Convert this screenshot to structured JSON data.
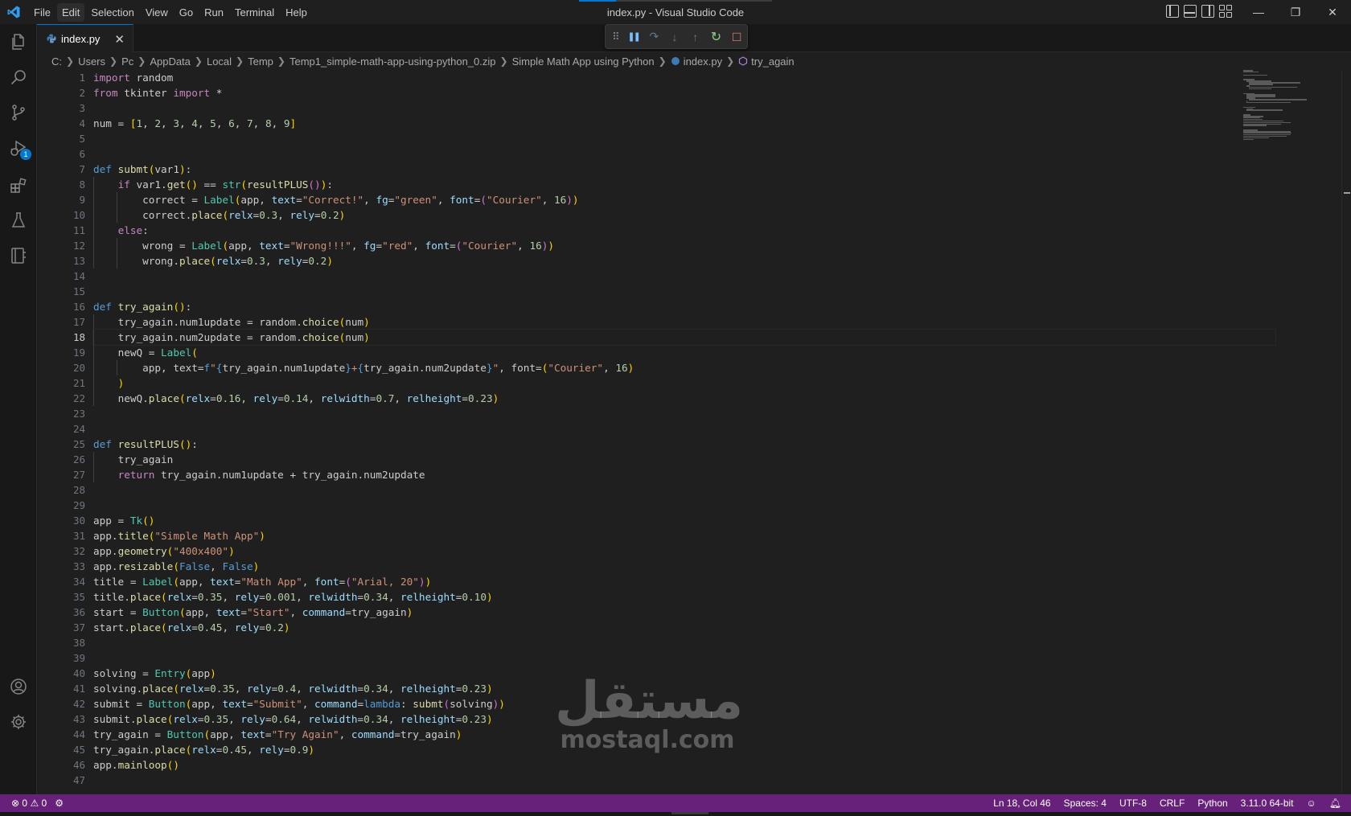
{
  "window": {
    "title": "index.py - Visual Studio Code",
    "menu": [
      "File",
      "Edit",
      "Selection",
      "View",
      "Go",
      "Run",
      "Terminal",
      "Help"
    ],
    "active_menu": "Edit",
    "controls": {
      "minimize": "—",
      "restore": "❐",
      "close": "✕"
    }
  },
  "activity_bar": {
    "items": [
      "explorer",
      "search",
      "source-control",
      "run-and-debug",
      "extensions",
      "testing",
      "remote-explorer"
    ],
    "debug_badge": "1",
    "bottom": [
      "accounts",
      "manage"
    ]
  },
  "tab": {
    "label": "index.py",
    "close": "✕",
    "language_icon": "python-icon"
  },
  "debug_toolbar": {
    "items": [
      "drag-handle",
      "pause",
      "step-over",
      "step-into",
      "step-out",
      "restart",
      "stop"
    ],
    "glyphs": {
      "grip": "⠿",
      "pause": "❚❚",
      "step_over": "↷",
      "step_into": "↓",
      "step_out": "↑",
      "restart": "↻",
      "stop": "□"
    }
  },
  "editor_actions": {
    "run": "▷",
    "run_menu": "⌄",
    "split": "◫",
    "more": "···"
  },
  "breadcrumb": {
    "segments": [
      "C:",
      "Users",
      "Pc",
      "AppData",
      "Local",
      "Temp",
      "Temp1_simple-math-app-using-python_0.zip",
      "Simple Math App using Python",
      "index.py",
      "try_again"
    ]
  },
  "editor": {
    "current_line": 18,
    "line_numbers": [
      "1",
      "2",
      "3",
      "4",
      "5",
      "6",
      "7",
      "8",
      "9",
      "10",
      "11",
      "12",
      "13",
      "14",
      "15",
      "16",
      "17",
      "18",
      "19",
      "20",
      "21",
      "22",
      "23",
      "24",
      "25",
      "26",
      "27",
      "28",
      "29",
      "30",
      "31",
      "32",
      "33",
      "34",
      "35",
      "36",
      "37",
      "38",
      "39",
      "40",
      "41",
      "42",
      "43",
      "44",
      "45",
      "46",
      "47"
    ],
    "lines": [
      "import random",
      "from tkinter import *",
      "",
      "num = [1, 2, 3, 4, 5, 6, 7, 8, 9]",
      "",
      "",
      "def submt(var1):",
      "    if var1.get() == str(resultPLUS()):",
      "        correct = Label(app, text=\"Correct!\", fg=\"green\", font=(\"Courier\", 16))",
      "        correct.place(relx=0.3, rely=0.2)",
      "    else:",
      "        wrong = Label(app, text=\"Wrong!!!\", fg=\"red\", font=(\"Courier\", 16))",
      "        wrong.place(relx=0.3, rely=0.2)",
      "",
      "",
      "def try_again():",
      "    try_again.num1update = random.choice(num)",
      "    try_again.num2update = random.choice(num)",
      "    newQ = Label(",
      "        app, text=f\"{try_again.num1update}+{try_again.num2update}\", font=(\"Courier\", 16)",
      "    )",
      "    newQ.place(relx=0.16, rely=0.14, relwidth=0.7, relheight=0.23)",
      "",
      "",
      "def resultPLUS():",
      "    try_again",
      "    return try_again.num1update + try_again.num2update",
      "",
      "",
      "app = Tk()",
      "app.title(\"Simple Math App\")",
      "app.geometry(\"400x400\")",
      "app.resizable(False, False)",
      "title = Label(app, text=\"Math App\", font=(\"Arial, 20\"))",
      "title.place(relx=0.35, rely=0.001, relwidth=0.34, relheight=0.10)",
      "start = Button(app, text=\"Start\", command=try_again)",
      "start.place(relx=0.45, rely=0.2)",
      "",
      "",
      "solving = Entry(app)",
      "solving.place(relx=0.35, rely=0.4, relwidth=0.34, relheight=0.23)",
      "submit = Button(app, text=\"Submit\", command=lambda: submt(solving))",
      "submit.place(relx=0.35, rely=0.64, relwidth=0.34, relheight=0.23)",
      "try_again = Button(app, text=\"Try Again\", command=try_again)",
      "try_again.place(relx=0.45, rely=0.9)",
      "app.mainloop()",
      ""
    ]
  },
  "watermark": {
    "arabic": "مستقل",
    "latin": "mostaql.com"
  },
  "status_bar": {
    "errors": "0",
    "warnings": "0",
    "position": "Ln 18, Col 46",
    "indent": "Spaces: 4",
    "encoding": "UTF-8",
    "eol": "CRLF",
    "language": "Python",
    "interpreter": "3.11.0 64-bit",
    "color": "#68217a"
  },
  "theme": {
    "accent": "#0078d4",
    "editor_bg": "#1f1f1f"
  }
}
